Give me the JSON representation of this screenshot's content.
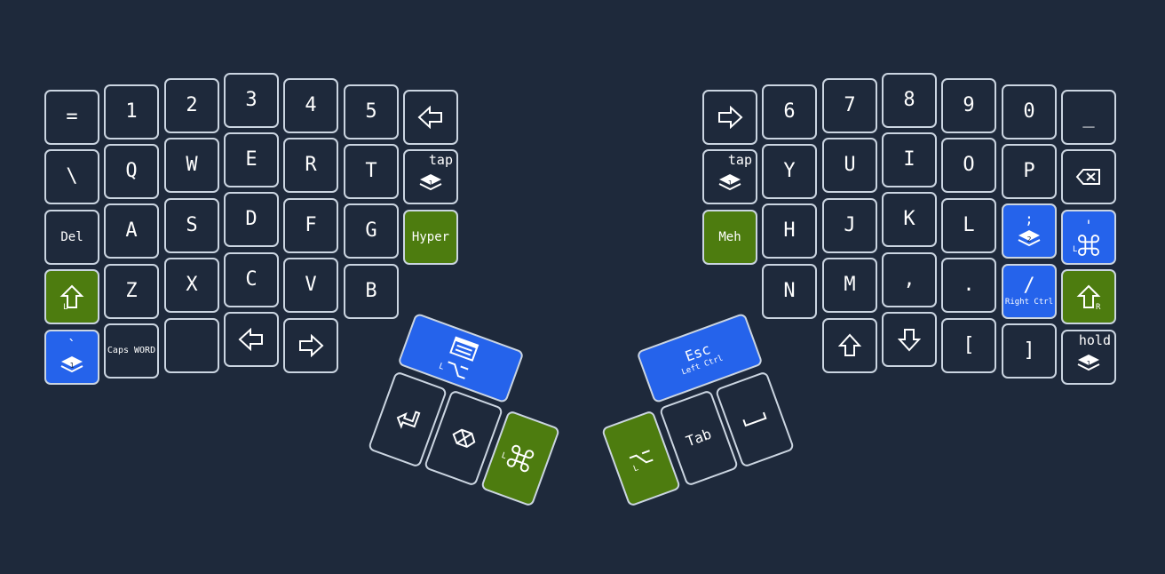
{
  "colors": {
    "background": "#1e293b",
    "key_border": "#cbd5e1",
    "hold_green": "#4d7c0f",
    "layer_blue": "#2563eb",
    "text": "#ffffff"
  },
  "left": {
    "row0": [
      "=",
      "1",
      "2",
      "3",
      "4",
      "5",
      "left-arrow-icon"
    ],
    "row1": [
      "\\",
      "Q",
      "W",
      "E",
      "R",
      "T",
      "layer-tap-icon"
    ],
    "row2": [
      "Del",
      "A",
      "S",
      "D",
      "F",
      "G",
      "Hyper"
    ],
    "row3": [
      "left-shift-icon",
      "Z",
      "X",
      "C",
      "V",
      "B"
    ],
    "row4": [
      "`",
      "Caps WORD",
      "",
      "left-arrow-icon",
      "right-arrow-icon"
    ],
    "keys": {
      "equals": "=",
      "n1": "1",
      "n2": "2",
      "n3": "3",
      "n4": "4",
      "n5": "5",
      "backslash": "\\",
      "q": "Q",
      "w": "W",
      "e": "E",
      "r": "R",
      "t": "T",
      "tap_label": "tap",
      "tap_layer": "1",
      "del": "Del",
      "a": "A",
      "s": "S",
      "d": "D",
      "f": "F",
      "g": "G",
      "hyper": "Hyper",
      "shift_mod": "L",
      "z": "Z",
      "x": "X",
      "c": "C",
      "v": "V",
      "b": "B",
      "grave": "`",
      "grave_layer": "1",
      "caps_word": "Caps WORD",
      "empty": ""
    },
    "thumb": {
      "alt_mod": "L",
      "cmd_mod": "L"
    }
  },
  "right": {
    "keys": {
      "n6": "6",
      "n7": "7",
      "n8": "8",
      "n9": "9",
      "n0": "0",
      "minus": "_",
      "tap_label": "tap",
      "tap_layer": "1",
      "y": "Y",
      "u": "U",
      "i": "I",
      "o": "O",
      "p": "P",
      "meh": "Meh",
      "h": "H",
      "j": "J",
      "k": "K",
      "l": "L",
      "semicolon": ";",
      "semicolon_layer": "2",
      "quote": "'",
      "quote_mod": "L",
      "n": "N",
      "m": "M",
      "comma": ",",
      "period": ".",
      "slash": "/",
      "slash_hold": "Right Ctrl",
      "shift_mod": "R",
      "lbracket": "[",
      "rbracket": "]",
      "hold_label": "hold",
      "hold_layer": "1"
    },
    "thumb": {
      "esc": "Esc",
      "esc_hold": "Left Ctrl",
      "alt_mod": "L",
      "tab": "Tab"
    }
  }
}
